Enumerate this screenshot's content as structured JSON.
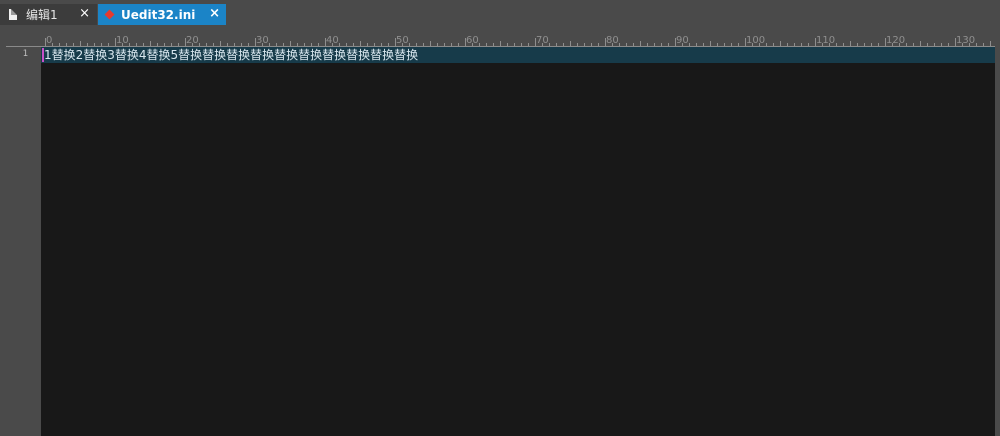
{
  "tabs": [
    {
      "label": "编辑1",
      "icon": "file-icon",
      "close": "×",
      "active": false
    },
    {
      "label": "Uedit32.ini",
      "icon": "diamond-icon",
      "close": "×",
      "active": true
    }
  ],
  "ruler": {
    "labels": [
      "0",
      "10",
      "20",
      "30",
      "40",
      "50",
      "60",
      "70",
      "80",
      "90",
      "100",
      "110",
      "120",
      "130"
    ]
  },
  "editor": {
    "line_numbers": [
      "1"
    ],
    "lines": [
      "1替换2替换3替换4替换5替换替换替换替换替换替换替换替换替换替换"
    ]
  },
  "colors": {
    "chrome": "#4a4a4a",
    "editor_bg": "#181818",
    "active_tab": "#1b84c7",
    "current_line": "#173b4a",
    "caret": "#c850c8"
  }
}
